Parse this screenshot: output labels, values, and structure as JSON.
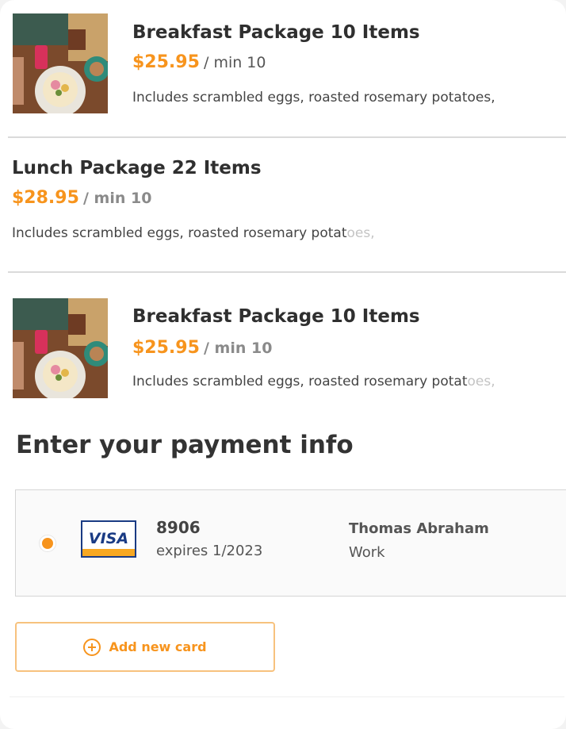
{
  "menu_items": [
    {
      "title": "Breakfast Package 10 Items",
      "price": "$25.95",
      "min": "/ min 10",
      "description_main": "Includes scrambled eggs, roasted rosemary potatoes,",
      "description_fade": "",
      "has_image": true,
      "image_icon": "breakfast-food-photo"
    },
    {
      "title": "Lunch Package 22 Items",
      "price": "$28.95",
      "min": "/ min 10",
      "description_main": "Includes scrambled eggs, roasted rosemary potat",
      "description_fade": "oes,",
      "has_image": false
    },
    {
      "title": "Breakfast Package 10 Items",
      "price": "$25.95",
      "min": "/ min 10",
      "description_main": "Includes scrambled eggs, roasted rosemary potat",
      "description_fade": "oes,",
      "has_image": true,
      "image_icon": "breakfast-food-photo"
    }
  ],
  "payment": {
    "section_title": "Enter your payment info",
    "card": {
      "brand": "VISA",
      "last_digits": "8906",
      "expiry": "expires 1/2023",
      "holder_name": "Thomas Abraham",
      "label": "Work",
      "selected": true
    },
    "add_card_label": "Add new card"
  },
  "colors": {
    "accent": "#f7941d",
    "visa_blue": "#1a3b84",
    "visa_gold": "#f7a823",
    "divider": "#dadada"
  }
}
